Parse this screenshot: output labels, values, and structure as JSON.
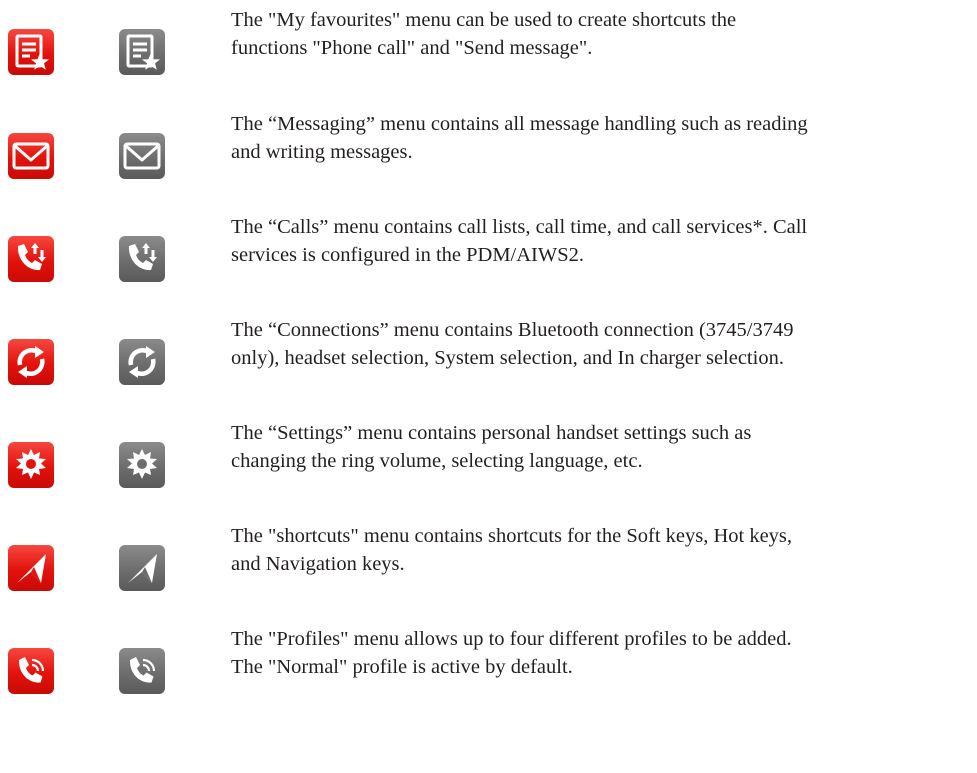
{
  "colors": {
    "active_icon": "#e3120b",
    "inactive_icon": "#6d6d6d",
    "text": "#231f20"
  },
  "items": [
    {
      "icon": "favourites-icon",
      "lines": [
        "The \"My favourites\" menu can be used to create shortcuts the",
        "functions \"Phone call\" and \"Send message\"."
      ]
    },
    {
      "icon": "messaging-icon",
      "lines": [
        "The “Messaging” menu contains all message handling such as reading",
        "and writing messages."
      ]
    },
    {
      "icon": "calls-icon",
      "lines": [
        "The “Calls” menu contains call lists, call time, and call services*. Call",
        "services is configured in the PDM/AIWS2."
      ]
    },
    {
      "icon": "connections-icon",
      "lines": [
        "The “Connections” menu contains Bluetooth connection (3745/3749",
        "only), headset selection, System selection, and In charger selection."
      ]
    },
    {
      "icon": "settings-icon",
      "lines": [
        "The “Settings” menu contains personal handset settings such as",
        "changing the ring volume, selecting language, etc."
      ]
    },
    {
      "icon": "shortcuts-icon",
      "lines": [
        "The \"shortcuts\" menu contains shortcuts for the Soft keys, Hot keys,",
        "and Navigation keys."
      ]
    },
    {
      "icon": "profiles-icon",
      "lines": [
        "The \"Profiles\" menu allows up to four different profiles to be added.",
        "The \"Normal\" profile is active by default."
      ]
    }
  ]
}
